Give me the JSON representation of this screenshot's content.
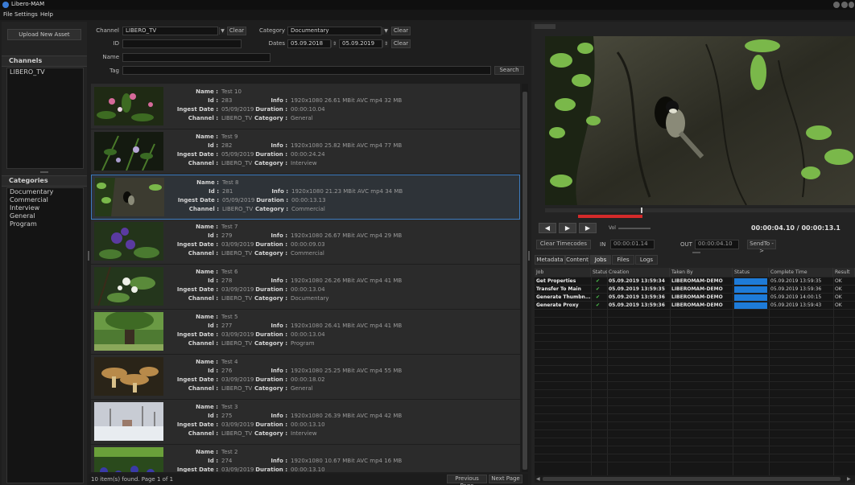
{
  "app": {
    "title": "Libero-MAM"
  },
  "menu": [
    "File",
    "Settings",
    "Help"
  ],
  "left": {
    "upload_label": "Upload New Asset",
    "channels_header": "Channels",
    "channels": [
      "LIBERO_TV"
    ],
    "categories_header": "Categories",
    "categories": [
      "Documentary",
      "Commercial",
      "Interview",
      "General",
      "Program"
    ]
  },
  "search": {
    "channel_label": "Channel",
    "channel_value": "LIBERO_TV",
    "clear_label": "Clear",
    "category_label": "Category",
    "category_value": "Documentary",
    "id_label": "ID",
    "dates_label": "Dates",
    "date_from": "05.09.2018",
    "date_to": "05.09.2019",
    "name_label": "Name",
    "tag_label": "Tag",
    "search_label": "Search"
  },
  "result_labels": {
    "name": "Name :",
    "id": "Id :",
    "ingest": "Ingest Date :",
    "channel": "Channel :",
    "info": "Info :",
    "duration": "Duration :",
    "category": "Category :"
  },
  "results": [
    {
      "name": "Test 10",
      "id": "283",
      "ingest": "05/09/2019",
      "channel": "LIBERO_TV",
      "info": "1920x1080 26.61 MBit AVC  mp4  32 MB",
      "duration": "00:00:10.04",
      "category": "General",
      "thumb": "flowers-pink"
    },
    {
      "name": "Test 9",
      "id": "282",
      "ingest": "05/09/2019",
      "channel": "LIBERO_TV",
      "info": "1920x1080 25.82 MBit AVC  mp4  77 MB",
      "duration": "00:00:24.24",
      "category": "Interview",
      "thumb": "plant-dark"
    },
    {
      "name": "Test 8",
      "id": "281",
      "ingest": "05/09/2019",
      "channel": "LIBERO_TV",
      "info": "1920x1080 21.23 MBit AVC  mp4  34 MB",
      "duration": "00:00:13.13",
      "category": "Commercial",
      "thumb": "tree-bark"
    },
    {
      "name": "Test 7",
      "id": "279",
      "ingest": "03/09/2019",
      "channel": "LIBERO_TV",
      "info": "1920x1080 26.67 MBit AVC  mp4  29 MB",
      "duration": "00:00:09.03",
      "category": "Commercial",
      "thumb": "flowers-purple"
    },
    {
      "name": "Test 6",
      "id": "278",
      "ingest": "03/09/2019",
      "channel": "LIBERO_TV",
      "info": "1920x1080 26.26 MBit AVC  mp4  41 MB",
      "duration": "00:00:13.04",
      "category": "Documentary",
      "thumb": "flowers-white"
    },
    {
      "name": "Test 5",
      "id": "277",
      "ingest": "03/09/2019",
      "channel": "LIBERO_TV",
      "info": "1920x1080 26.41 MBit AVC  mp4  41 MB",
      "duration": "00:00:13.04",
      "category": "Program",
      "thumb": "tree-park"
    },
    {
      "name": "Test 4",
      "id": "276",
      "ingest": "03/09/2019",
      "channel": "LIBERO_TV",
      "info": "1920x1080 25.25 MBit AVC  mp4  55 MB",
      "duration": "00:00:18.02",
      "category": "General",
      "thumb": "mushrooms"
    },
    {
      "name": "Test 3",
      "id": "275",
      "ingest": "03/09/2019",
      "channel": "LIBERO_TV",
      "info": "1920x1080 26.39 MBit AVC  mp4  42 MB",
      "duration": "00:00:13.10",
      "category": "Interview",
      "thumb": "snow"
    },
    {
      "name": "Test 2",
      "id": "274",
      "ingest": "03/09/2019",
      "channel": "LIBERO_TV",
      "info": "1920x1080 10.67 MBit AVC  mp4  16 MB",
      "duration": "00:00:13.10",
      "category": "General",
      "thumb": "blue-flowers"
    }
  ],
  "status": {
    "found": "10 item(s) found. Page 1 of 1",
    "prev": "Previous Page",
    "next": "Next Page"
  },
  "player": {
    "vol_label": "Vol",
    "timecode": "00:00:04.10 / 00:00:13.1",
    "clear_tc": "Clear Timecodes",
    "in_label": "IN",
    "in_value": "00:00:01.14",
    "out_label": "OUT",
    "out_value": "00:00:04.10",
    "sendto": "SendTo ->",
    "progress": 0.31
  },
  "tabs": [
    "Metadata",
    "Content",
    "Jobs",
    "Files",
    "Logs"
  ],
  "jobs": {
    "headers": [
      "Job",
      "Status",
      "Creation",
      "Taken By",
      "Status",
      "Complete Time",
      "Result"
    ],
    "rows": [
      {
        "job": "Get Properties",
        "creation": "05.09.2019 13:59:34",
        "taken": "LIBEROMAM-DEMO",
        "complete": "05.09.2019 13:59:35",
        "result": "OK"
      },
      {
        "job": "Transfer To Main",
        "creation": "05.09.2019 13:59:35",
        "taken": "LIBEROMAM-DEMO",
        "complete": "05.09.2019 13:59:36",
        "result": "OK"
      },
      {
        "job": "Generate Thumbn...",
        "creation": "05.09.2019 13:59:36",
        "taken": "LIBEROMAM-DEMO",
        "complete": "05.09.2019 14:00:15",
        "result": "OK"
      },
      {
        "job": "Generate Proxy",
        "creation": "05.09.2019 13:59:36",
        "taken": "LIBEROMAM-DEMO",
        "complete": "05.09.2019 13:59:43",
        "result": "OK"
      }
    ]
  },
  "colors": {
    "accent": "#3d7bbf",
    "progress": "#1e7bd8",
    "check": "#4cc24c",
    "scrub": "#d42a2a"
  }
}
